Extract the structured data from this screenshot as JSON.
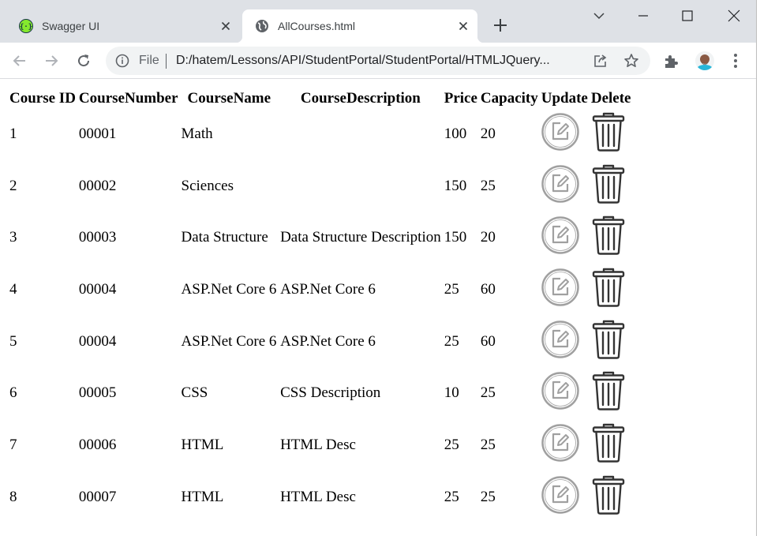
{
  "browser": {
    "tabs": [
      {
        "title": "Swagger UI",
        "icon": "swagger-icon",
        "active": false
      },
      {
        "title": "AllCourses.html",
        "icon": "globe-icon",
        "active": true
      }
    ],
    "address": {
      "scheme_label": "File",
      "url": "D:/hatem/Lessons/API/StudentPortal/StudentPortal/HTMLJQuery..."
    }
  },
  "table": {
    "headers": [
      "Course ID",
      "CourseNumber",
      "CourseName",
      "CourseDescription",
      "Price",
      "Capacity",
      "Update",
      "Delete"
    ],
    "rows": [
      {
        "id": "1",
        "number": "00001",
        "name": "Math",
        "description": "",
        "price": "100",
        "capacity": "20"
      },
      {
        "id": "2",
        "number": "00002",
        "name": "Sciences",
        "description": "",
        "price": "150",
        "capacity": "25"
      },
      {
        "id": "3",
        "number": "00003",
        "name": "Data Structure",
        "description": "Data Structure Description",
        "price": "150",
        "capacity": "20"
      },
      {
        "id": "4",
        "number": "00004",
        "name": "ASP.Net Core 6",
        "description": "ASP.Net Core 6",
        "price": "25",
        "capacity": "60"
      },
      {
        "id": "5",
        "number": "00004",
        "name": "ASP.Net Core 6",
        "description": "ASP.Net Core 6",
        "price": "25",
        "capacity": "60"
      },
      {
        "id": "6",
        "number": "00005",
        "name": "CSS",
        "description": "CSS Description",
        "price": "10",
        "capacity": "25"
      },
      {
        "id": "7",
        "number": "00006",
        "name": "HTML",
        "description": "HTML Desc",
        "price": "25",
        "capacity": "25"
      },
      {
        "id": "8",
        "number": "00007",
        "name": "HTML",
        "description": "HTML Desc",
        "price": "25",
        "capacity": "25"
      }
    ]
  },
  "colors": {
    "tabstrip": "#dee1e6",
    "swagger_green": "#85ea2d",
    "edit_icon_gray": "#a0a0a0",
    "delete_icon_dark": "#333333"
  }
}
